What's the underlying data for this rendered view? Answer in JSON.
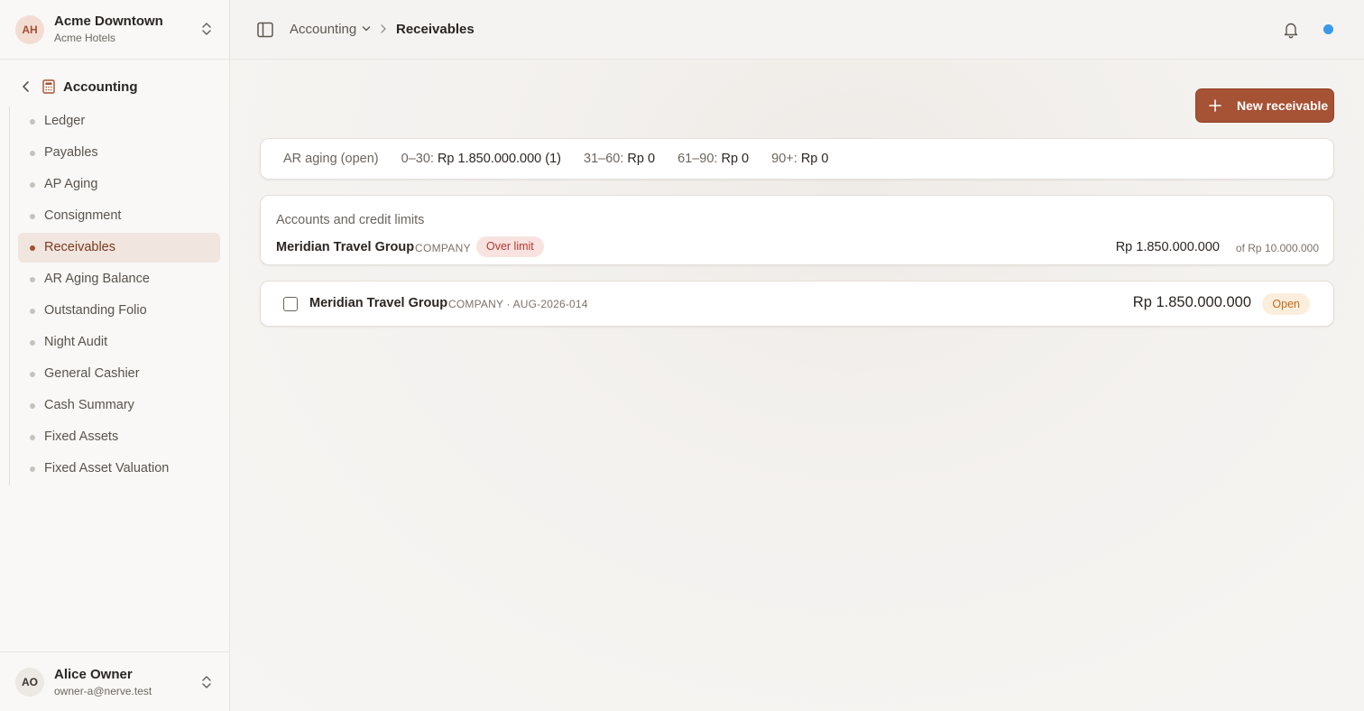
{
  "org": {
    "initials": "AH",
    "name": "Acme Downtown",
    "subtitle": "Acme Hotels"
  },
  "section": {
    "title": "Accounting"
  },
  "nav": {
    "items": [
      {
        "label": "Ledger"
      },
      {
        "label": "Payables"
      },
      {
        "label": "AP Aging"
      },
      {
        "label": "Consignment"
      },
      {
        "label": "Receivables",
        "active": true
      },
      {
        "label": "AR Aging Balance"
      },
      {
        "label": "Outstanding Folio"
      },
      {
        "label": "Night Audit"
      },
      {
        "label": "General Cashier"
      },
      {
        "label": "Cash Summary"
      },
      {
        "label": "Fixed Assets"
      },
      {
        "label": "Fixed Asset Valuation"
      }
    ]
  },
  "user": {
    "initials": "AO",
    "name": "Alice Owner",
    "email": "owner-a@nerve.test"
  },
  "breadcrumb": {
    "parent": "Accounting",
    "current": "Receivables"
  },
  "actions": {
    "new_label": "New receivable"
  },
  "aging": {
    "title": "AR aging (open)",
    "buckets": [
      {
        "label": "0–30:",
        "value": "Rp 1.850.000.000 (1)"
      },
      {
        "label": "31–60:",
        "value": "Rp 0"
      },
      {
        "label": "61–90:",
        "value": "Rp 0"
      },
      {
        "label": "90+:",
        "value": "Rp 0"
      }
    ]
  },
  "accounts": {
    "title": "Accounts and credit limits",
    "rows": [
      {
        "name": "Meridian Travel Group",
        "type": "COMPANY",
        "badge": "Over limit",
        "amount": "Rp 1.850.000.000",
        "limit": "of Rp 10.000.000"
      }
    ]
  },
  "receivables": [
    {
      "name": "Meridian Travel Group",
      "meta": "COMPANY · AUG-2026-014",
      "amount": "Rp 1.850.000.000",
      "status": "Open"
    }
  ],
  "colors": {
    "accent": "#a65234",
    "over_limit": "#b23a32",
    "open": "#c06a1a",
    "status_dot": "#3a9ae8"
  },
  "icons": [
    "chevrons-up-down-icon",
    "chevron-left-icon",
    "calculator-icon",
    "sidebar-toggle-icon",
    "chevron-down-icon",
    "chevron-right-icon",
    "bell-icon",
    "plus-icon"
  ]
}
